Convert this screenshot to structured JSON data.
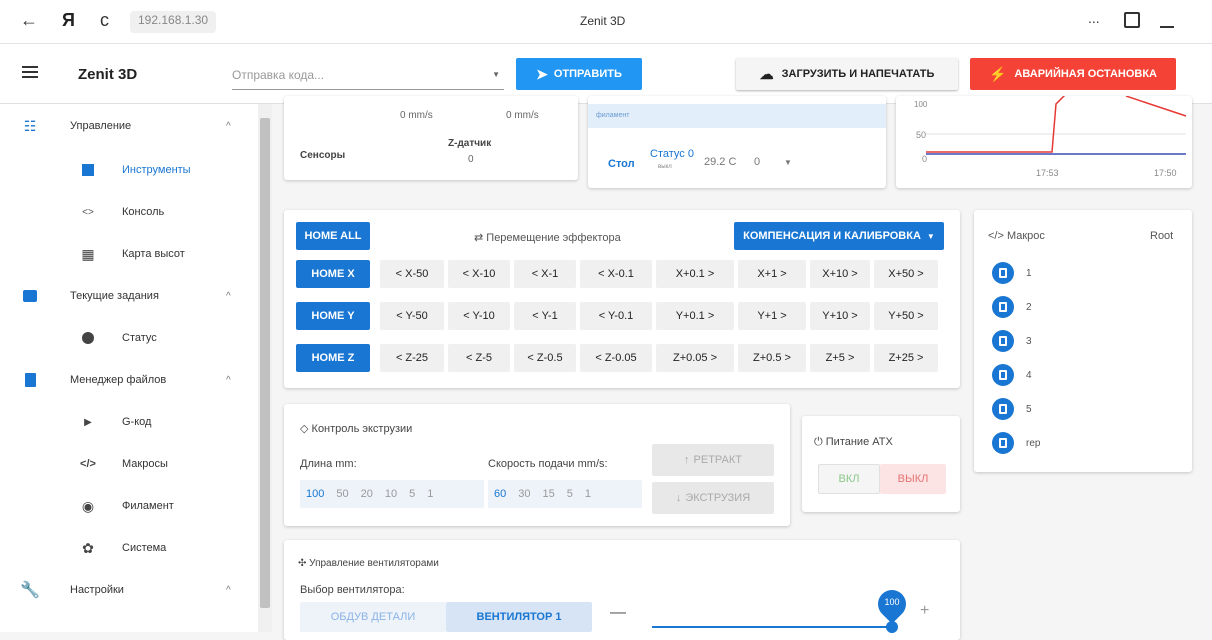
{
  "browser": {
    "url": "192.168.1.30",
    "tab_title": "Zenit 3D",
    "back_icon": "←",
    "yandex_logo": "Я",
    "reload_icon": "c",
    "more": "..."
  },
  "appbar": {
    "title": "Zenit 3D",
    "send_placeholder": "Отправка кода...",
    "send_label": "ОТПРАВИТЬ",
    "upload_label": "ЗАГРУЗИТЬ И НАПЕЧАТАТЬ",
    "estop_label": "АВАРИЙНАЯ ОСТАНОВКА"
  },
  "sidebar": {
    "items": [
      {
        "label": "Управление",
        "chevron": "^"
      },
      {
        "label": "Инструменты"
      },
      {
        "label": "Консоль",
        "icon_glyph": "<>"
      },
      {
        "label": "Карта высот"
      },
      {
        "label": "Текущие задания",
        "chevron": "^"
      },
      {
        "label": "Статус"
      },
      {
        "label": "Менеджер файлов",
        "chevron": "^"
      },
      {
        "label": "G-код"
      },
      {
        "label": "Макросы"
      },
      {
        "label": "Филамент"
      },
      {
        "label": "Система"
      },
      {
        "label": "Настройки",
        "chevron": "^"
      }
    ]
  },
  "status_card": {
    "speed1": "0 mm/s",
    "speed2": "0 mm/s",
    "sensors_label": "Сенсоры",
    "zprobe_label": "Z-датчик",
    "zprobe_value": "0"
  },
  "heater_card": {
    "filament_label": "филамент",
    "bed_label": "Стол",
    "status_label": "Статус 0",
    "status_sub": "выкл",
    "bed_temp": "29.2 C",
    "bed_target": "0"
  },
  "temp_chart": {
    "y_ticks": [
      "100",
      "50",
      "0"
    ],
    "x_ticks": [
      "17:53",
      "17:50"
    ]
  },
  "movement": {
    "home_all": "HOME ALL",
    "title": "Перемещение эффектора",
    "title_icon": "⇄",
    "comp_label": "КОМПЕНСАЦИЯ И КАЛИБРОВКА",
    "rows": [
      {
        "home": "HOME X",
        "steps": [
          "< X-50",
          "< X-10",
          "< X-1",
          "< X-0.1",
          "X+0.1 >",
          "X+1 >",
          "X+10 >",
          "X+50 >"
        ]
      },
      {
        "home": "HOME Y",
        "steps": [
          "< Y-50",
          "< Y-10",
          "< Y-1",
          "< Y-0.1",
          "Y+0.1 >",
          "Y+1 >",
          "Y+10 >",
          "Y+50 >"
        ]
      },
      {
        "home": "HOME Z",
        "steps": [
          "< Z-25",
          "< Z-5",
          "< Z-0.5",
          "< Z-0.05",
          "Z+0.05 >",
          "Z+0.5 >",
          "Z+5 >",
          "Z+25 >"
        ]
      }
    ]
  },
  "macros": {
    "title": "Макрос",
    "title_icon": "</>",
    "root": "Root",
    "items": [
      "1",
      "2",
      "3",
      "4",
      "5",
      "rep"
    ]
  },
  "extrusion": {
    "title": "Контроль экструзии",
    "length_label": "Длина mm:",
    "lengths": [
      "100",
      "50",
      "20",
      "10",
      "5",
      "1"
    ],
    "feed_label": "Скорость подачи mm/s:",
    "feeds": [
      "60",
      "30",
      "15",
      "5",
      "1"
    ],
    "retract_label": "РЕТРАКТ",
    "extrude_label": "ЭКСТРУЗИЯ"
  },
  "atx": {
    "title": "Питание ATX",
    "on_label": "ВКЛ",
    "off_label": "ВЫКЛ"
  },
  "fans": {
    "title": "Управление вентиляторами",
    "select_label": "Выбор вентилятора:",
    "tab1": "ОБДУВ ДЕТАЛИ",
    "tab2": "ВЕНТИЛЯТОР 1",
    "minus": "—",
    "plus": "+",
    "value": "100",
    "value_fraction": 1.0
  }
}
